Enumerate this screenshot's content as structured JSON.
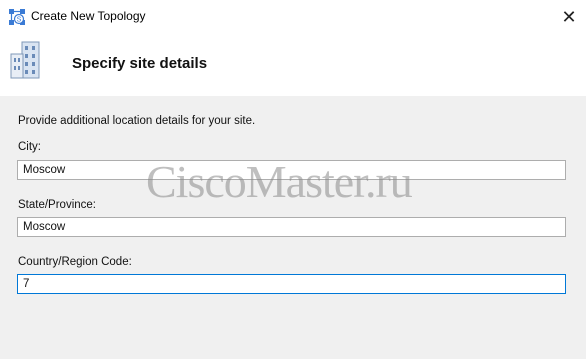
{
  "window": {
    "title": "Create New Topology",
    "close_glyph": "✕",
    "app_icon": "topology-icon"
  },
  "header": {
    "title": "Specify site details",
    "icon": "building-icon"
  },
  "form": {
    "description": "Provide additional location details for your site.",
    "city": {
      "label": "City:",
      "value": "Moscow"
    },
    "state": {
      "label": "State/Province:",
      "value": "Moscow"
    },
    "country": {
      "label": "Country/Region Code:",
      "value": "7"
    }
  },
  "watermark": {
    "text": "CiscoMaster.ru"
  },
  "colors": {
    "focus_border": "#0078d7",
    "window_bg": "#f0f0f0",
    "header_bg": "#ffffff"
  }
}
